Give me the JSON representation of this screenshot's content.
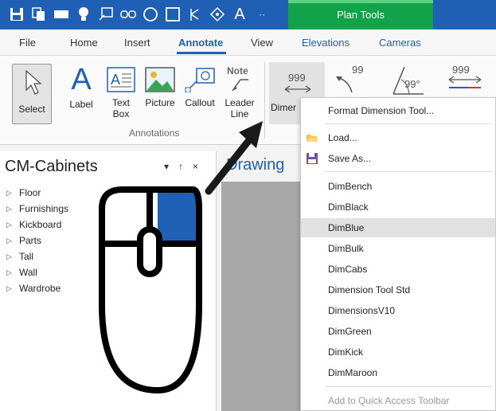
{
  "qat": {
    "icons": [
      "save-icon",
      "copy-icon",
      "rectangle-fill-icon",
      "bulb-icon",
      "note-icon",
      "chain-icon",
      "circle-icon",
      "square-icon",
      "fork-icon",
      "diamond-icon",
      "text-icon",
      "more-icon"
    ],
    "note_label": "Note",
    "text_label": "A",
    "more_label": "··",
    "context_tab": "Plan Tools"
  },
  "tabs": [
    "File",
    "Home",
    "Insert",
    "Annotate",
    "View",
    "Elevations",
    "Cameras"
  ],
  "active_tab": "Annotate",
  "ribbon": {
    "select": "Select",
    "label": "Label",
    "text_box_line1": "Text",
    "text_box_line2": "Box",
    "picture": "Picture",
    "callout": "Callout",
    "leader_line1": "Leader",
    "leader_line2": "Line",
    "leader_note": "Note",
    "group_label": "Annotations",
    "dimension_partial": "Dimer",
    "dim_value_1": "999",
    "dim_value_2": "99",
    "dim_value_3": "99°",
    "dim_value_4": "999"
  },
  "panel": {
    "title": "CM-Cabinets",
    "ctrl_dropdown": "▾",
    "ctrl_pin": "↑",
    "ctrl_close": "×",
    "tree": [
      "Floor",
      "Furnishings",
      "Kickboard",
      "Parts",
      "Tall",
      "Wall",
      "Wardrobe"
    ]
  },
  "drawing": {
    "tab_label": "Drawing"
  },
  "menu": {
    "format": "Format Dimension Tool...",
    "load": "Load...",
    "save_as": "Save As...",
    "items": [
      "DimBench",
      "DimBlack",
      "DimBlue",
      "DimBulk",
      "DimCabs",
      "Dimension Tool Std",
      "DimensionsV10",
      "DimGreen",
      "DimKick",
      "DimMaroon"
    ],
    "highlighted": "DimBlue",
    "quick_access": "Add to Quick Access Toolbar"
  },
  "colors": {
    "accent": "#1f5fb4",
    "context_tab": "#12a24a",
    "mouse_button": "#1f5fb4"
  }
}
